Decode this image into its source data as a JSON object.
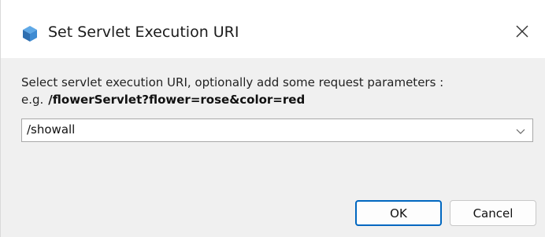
{
  "window": {
    "title": "Set Servlet Execution URI",
    "app_icon": "cube-icon",
    "close_icon": "close-icon"
  },
  "main": {
    "instruction": "Select servlet execution URI, optionally add some request parameters :",
    "example_prefix": "e.g.",
    "example_value": "/flowerServlet?flower=rose&color=red"
  },
  "combo": {
    "value": "/showall",
    "arrow_icon": "chevron-down-icon"
  },
  "buttons": {
    "ok": "OK",
    "cancel": "Cancel"
  },
  "colors": {
    "accent": "#0067c0",
    "content_bg": "#f0f0f0"
  }
}
